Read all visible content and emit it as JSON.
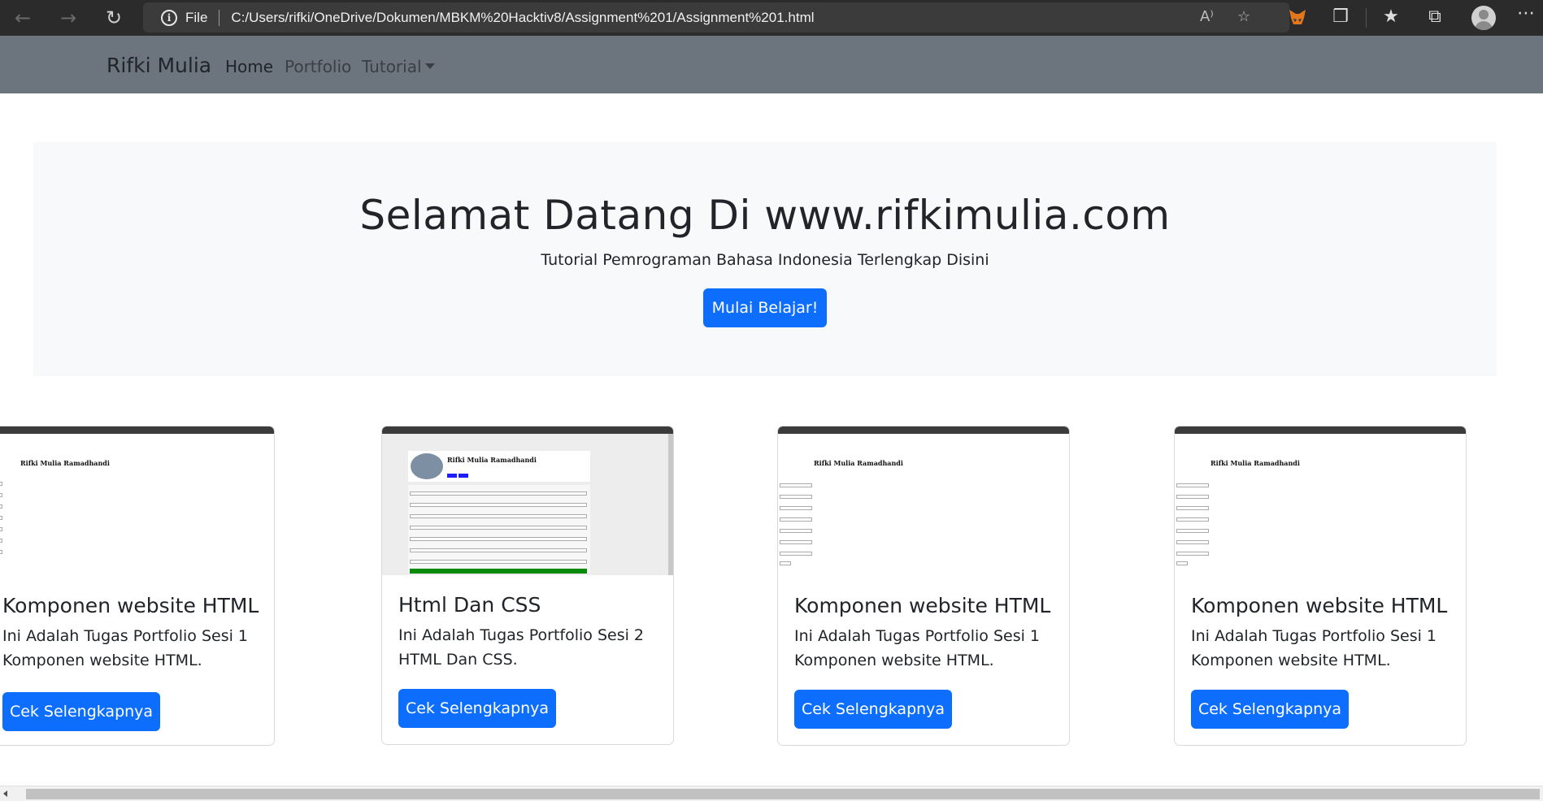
{
  "browser": {
    "back_icon": "arrow-left-icon",
    "forward_icon": "arrow-right-icon",
    "reload_icon": "reload-icon",
    "site_info_icon": "info-icon",
    "scheme_label": "File",
    "url": "C:/Users/rifki/OneDrive/Dokumen/MBKM%20Hacktiv8/Assignment%201/Assignment%201.html"
  },
  "navbar": {
    "brand": "Rifki Mulia",
    "items": [
      {
        "label": "Home"
      },
      {
        "label": "Portfolio"
      },
      {
        "label": "Tutorial"
      }
    ]
  },
  "hero": {
    "title": "Selamat Datang Di www.rifkimulia.com",
    "subtitle": "Tutorial Pemrograman Bahasa Indonesia Terlengkap Disini",
    "button": "Mulai Belajar!"
  },
  "cards": [
    {
      "title": "Komponen website HTML",
      "text": "Ini Adalah Tugas Portfolio Sesi 1 Komponen website HTML.",
      "button": "Cek Selengkapnya",
      "thumb_title": "Rifki Mulia Ramadhandi"
    },
    {
      "title": "Html Dan CSS",
      "text": "Ini Adalah Tugas Portfolio Sesi 2 HTML Dan CSS.",
      "button": "Cek Selengkapnya",
      "thumb_title": "Rifki Mulia Ramadhandi"
    },
    {
      "title": "Komponen website HTML",
      "text": "Ini Adalah Tugas Portfolio Sesi 1 Komponen website HTML.",
      "button": "Cek Selengkapnya",
      "thumb_title": "Rifki Mulia Ramadhandi"
    },
    {
      "title": "Komponen website HTML",
      "text": "Ini Adalah Tugas Portfolio Sesi 1 Komponen website HTML.",
      "button": "Cek Selengkapnya",
      "thumb_title": "Rifki Mulia Ramadhandi"
    }
  ],
  "colors": {
    "navbar_bg": "#6c757d",
    "hero_bg": "#f8f9fa",
    "primary": "#0d6efd"
  }
}
